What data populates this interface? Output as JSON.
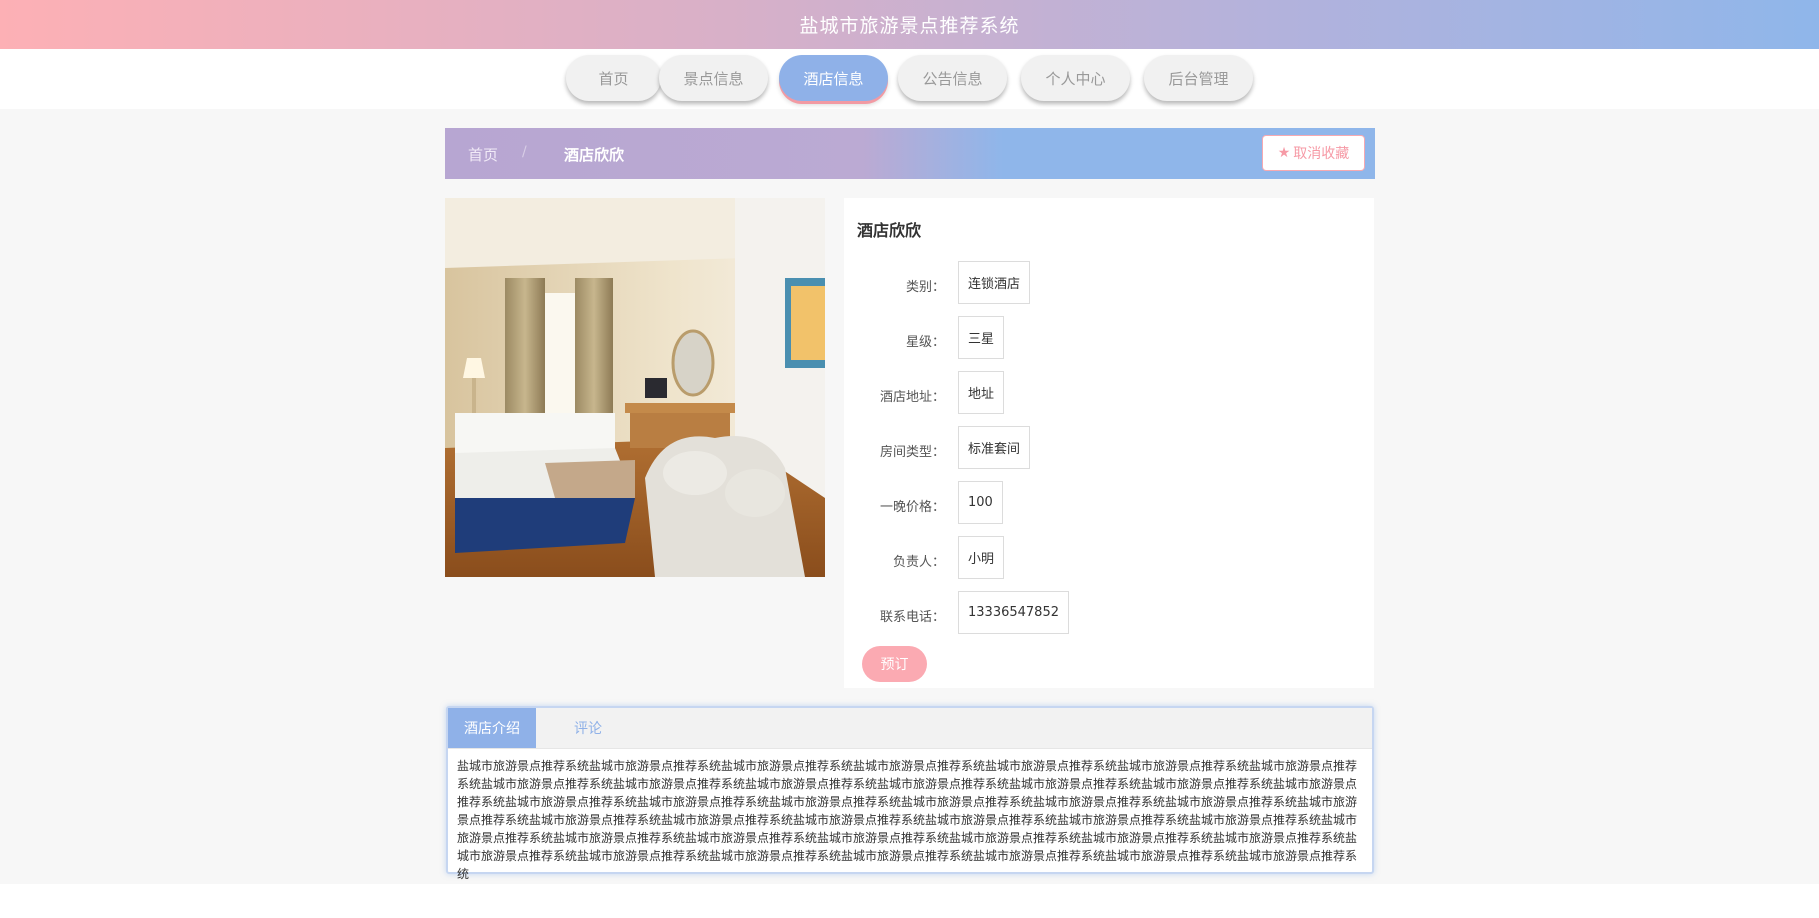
{
  "header": {
    "title": "盐城市旅游景点推荐系统"
  },
  "nav": {
    "items": [
      {
        "label": "首页"
      },
      {
        "label": "景点信息"
      },
      {
        "label": "酒店信息"
      },
      {
        "label": "公告信息"
      },
      {
        "label": "个人中心"
      },
      {
        "label": "后台管理"
      }
    ],
    "active": "酒店信息"
  },
  "breadcrumb": {
    "home": "首页",
    "separator": "/",
    "current": "酒店欣欣"
  },
  "favorite_button": {
    "icon": "star-icon",
    "label": "取消收藏"
  },
  "hotel": {
    "name": "酒店欣欣",
    "fields": [
      {
        "label": "类别：",
        "value": "连锁酒店"
      },
      {
        "label": "星级：",
        "value": "三星"
      },
      {
        "label": "酒店地址：",
        "value": "地址"
      },
      {
        "label": "房间类型：",
        "value": "标准套间"
      },
      {
        "label": "一晚价格：",
        "value": "100"
      },
      {
        "label": "负责人：",
        "value": "小明"
      },
      {
        "label": "联系电话：",
        "value": "13336547852"
      }
    ],
    "book_label": "预订"
  },
  "tabs": {
    "items": [
      {
        "label": "酒店介绍"
      },
      {
        "label": "评论"
      }
    ],
    "active": "酒店介绍",
    "content": "盐城市旅游景点推荐系统盐城市旅游景点推荐系统盐城市旅游景点推荐系统盐城市旅游景点推荐系统盐城市旅游景点推荐系统盐城市旅游景点推荐系统盐城市旅游景点推荐系统盐城市旅游景点推荐系统盐城市旅游景点推荐系统盐城市旅游景点推荐系统盐城市旅游景点推荐系统盐城市旅游景点推荐系统盐城市旅游景点推荐系统盐城市旅游景点推荐系统盐城市旅游景点推荐系统盐城市旅游景点推荐系统盐城市旅游景点推荐系统盐城市旅游景点推荐系统盐城市旅游景点推荐系统盐城市旅游景点推荐系统盐城市旅游景点推荐系统盐城市旅游景点推荐系统盐城市旅游景点推荐系统盐城市旅游景点推荐系统盐城市旅游景点推荐系统盐城市旅游景点推荐系统盐城市旅游景点推荐系统盐城市旅游景点推荐系统盐城市旅游景点推荐系统盐城市旅游景点推荐系统盐城市旅游景点推荐系统盐城市旅游景点推荐系统盐城市旅游景点推荐系统盐城市旅游景点推荐系统盐城市旅游景点推荐系统盐城市旅游景点推荐系统盐城市旅游景点推荐系统盐城市旅游景点推荐系统盐城市旅游景点推荐系统盐城市旅游景点推荐系统盐城市旅游景点推荐系统"
  },
  "colors": {
    "accent_blue": "#8fb1e8",
    "accent_pink": "#fbaab2",
    "header_gradient_start": "#fdb0b5",
    "header_gradient_end": "#8fb6ea"
  }
}
